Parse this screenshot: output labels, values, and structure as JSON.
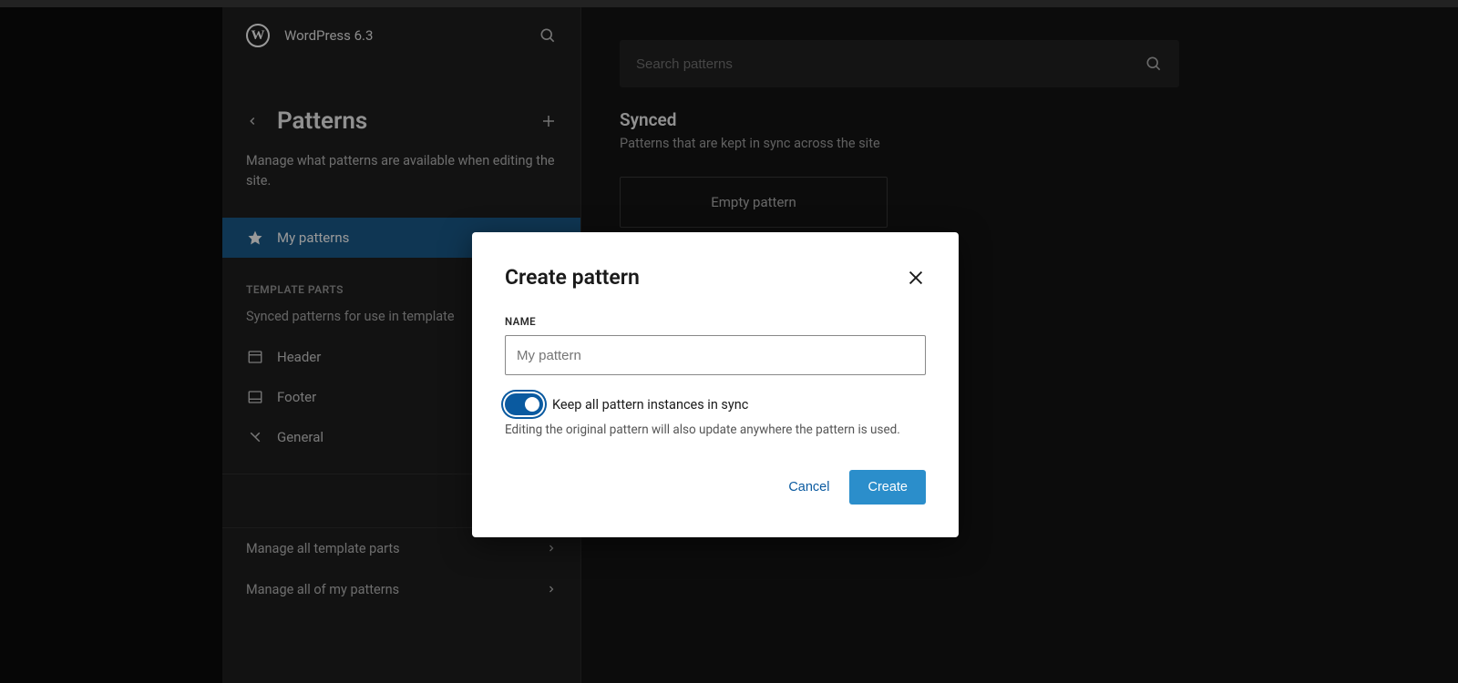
{
  "header": {
    "site_title": "WordPress 6.3"
  },
  "sidebar": {
    "section_title": "Patterns",
    "section_desc": "Manage what patterns are available when editing the site.",
    "my_patterns_label": "My patterns",
    "template_parts_heading": "TEMPLATE PARTS",
    "template_parts_desc": "Synced patterns for use in template",
    "parts": {
      "header": "Header",
      "footer": "Footer",
      "general": "General"
    },
    "footer_links": {
      "manage_parts": "Manage all template parts",
      "manage_patterns": "Manage all of my patterns"
    }
  },
  "main": {
    "search_placeholder": "Search patterns",
    "synced_heading": "Synced",
    "synced_desc": "Patterns that are kept in sync across the site",
    "empty_pattern_label": "Empty pattern"
  },
  "modal": {
    "title": "Create pattern",
    "name_label": "NAME",
    "name_placeholder": "My pattern",
    "toggle_label": "Keep all pattern instances in sync",
    "toggle_help": "Editing the original pattern will also update anywhere the pattern is used.",
    "cancel": "Cancel",
    "create": "Create"
  }
}
